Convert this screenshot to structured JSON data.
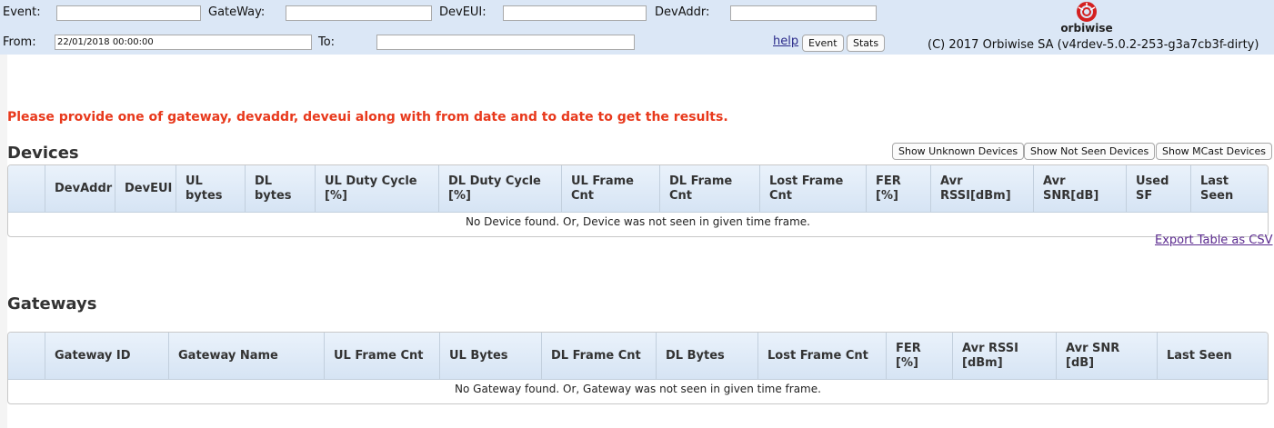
{
  "filters": {
    "event_label": "Event:",
    "event_value": "",
    "gateway_label": "GateWay:",
    "gateway_value": "",
    "deveui_label": "DevEUI:",
    "deveui_value": "",
    "devaddr_label": "DevAddr:",
    "devaddr_value": "",
    "from_label": "From:",
    "from_value": "22/01/2018 00:00:00",
    "to_label": "To:",
    "to_value": ""
  },
  "toolbar": {
    "help_label": "help",
    "event_button": "Event",
    "stats_button": "Stats"
  },
  "brand": {
    "logo_text": "orbiwise",
    "copyright": "(C) 2017 Orbiwise SA (v4rdev-5.0.2-253-g3a7cb3f-dirty)",
    "logo_color": "#d42020"
  },
  "message": "Please provide one of gateway, devaddr, deveui along with from date and to date to get the results.",
  "devices": {
    "title": "Devices",
    "buttons": [
      "Show Unknown Devices",
      "Show Not Seen Devices",
      "Show MCast Devices"
    ],
    "columns": [
      "",
      "DevAddr",
      "DevEUI",
      "UL bytes",
      "DL bytes",
      "UL Duty Cycle [%]",
      "DL Duty Cycle [%]",
      "UL Frame Cnt",
      "DL Frame Cnt",
      "Lost Frame Cnt",
      "FER [%]",
      "Avr RSSI[dBm]",
      "Avr SNR[dB]",
      "Used SF",
      "Last Seen"
    ],
    "empty_message": "No Device found. Or, Device was not seen in given time frame.",
    "export_label": "Export Table as CSV"
  },
  "gateways": {
    "title": "Gateways",
    "columns": [
      "",
      "Gateway ID",
      "Gateway Name",
      "UL Frame Cnt",
      "UL Bytes",
      "DL Frame Cnt",
      "DL Bytes",
      "Lost Frame Cnt",
      "FER [%]",
      "Avr RSSI [dBm]",
      "Avr SNR [dB]",
      "Last Seen"
    ],
    "empty_message": "No Gateway found. Or, Gateway was not seen in given time frame."
  },
  "colors": {
    "topbar_bg": "#dbe7f6",
    "error_text": "#e8391c",
    "table_header_bg": "#d6e4f4",
    "link_visited": "#5b2a8f"
  }
}
